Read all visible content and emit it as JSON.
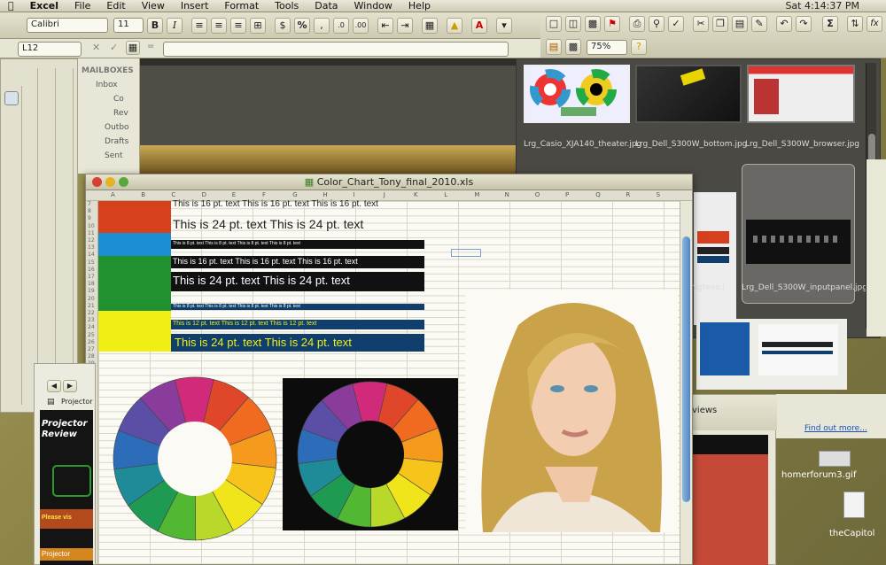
{
  "menubar": {
    "app": "Excel",
    "items": [
      "File",
      "Edit",
      "View",
      "Insert",
      "Format",
      "Tools",
      "Data",
      "Window",
      "Help"
    ],
    "clock": "Sat 4:14:37 PM"
  },
  "toolbar": {
    "font": "Calibri",
    "size": "11",
    "bold": "B",
    "italic": "I",
    "percent": "%",
    "comma": ",",
    "zoom": "75%",
    "sigma": "Σ",
    "fx": "fx"
  },
  "formula": {
    "cellref": "L12"
  },
  "mail": {
    "header": "MAILBOXES",
    "items": [
      "Inbox",
      "Co",
      "Rev",
      "Outbo",
      "Drafts",
      "Sent"
    ]
  },
  "browser": {
    "thumbs": [
      {
        "caption": "Lrg_Casio_XJA140_theater.jpg"
      },
      {
        "caption": "Lrg_Dell_S300W_bottom.jpg"
      },
      {
        "caption": "Lrg_Dell_S300W_browser.jpg"
      },
      {
        "caption": "highres.j"
      },
      {
        "caption": "Lrg_Dell_S300W_inputpanel.jpg"
      }
    ]
  },
  "excel": {
    "title": "Color_Chart_Tony_final_2010.xls",
    "columns": [
      "A",
      "B",
      "C",
      "D",
      "E",
      "F",
      "G",
      "H",
      "I",
      "J",
      "K",
      "L",
      "M",
      "N",
      "O",
      "P",
      "Q",
      "R",
      "S"
    ],
    "text16": "This is 16 pt. text  This is 16 pt. text  This is 16 pt. text",
    "text24": "This is 24 pt. text   This is 24 pt. text",
    "text12": "This is 12 pt. text   This is 12 pt. text   This is 12 pt. text",
    "text8": "This is 8 pt. text  This is 8 pt. text  This is 8 pt. text  This is 8 pt. text"
  },
  "side": {
    "find_more": "Find out more...",
    "reviews": "views",
    "file1": "homerforum3.gif",
    "file2": "theCapitol",
    "project": "Projector",
    "project2": "Review",
    "please": "Please vis"
  },
  "colors": {
    "red": "#d7401c",
    "blue": "#1c8fd4",
    "green": "#21902e",
    "yellow": "#f0ee14",
    "navy": "#103f6d"
  }
}
